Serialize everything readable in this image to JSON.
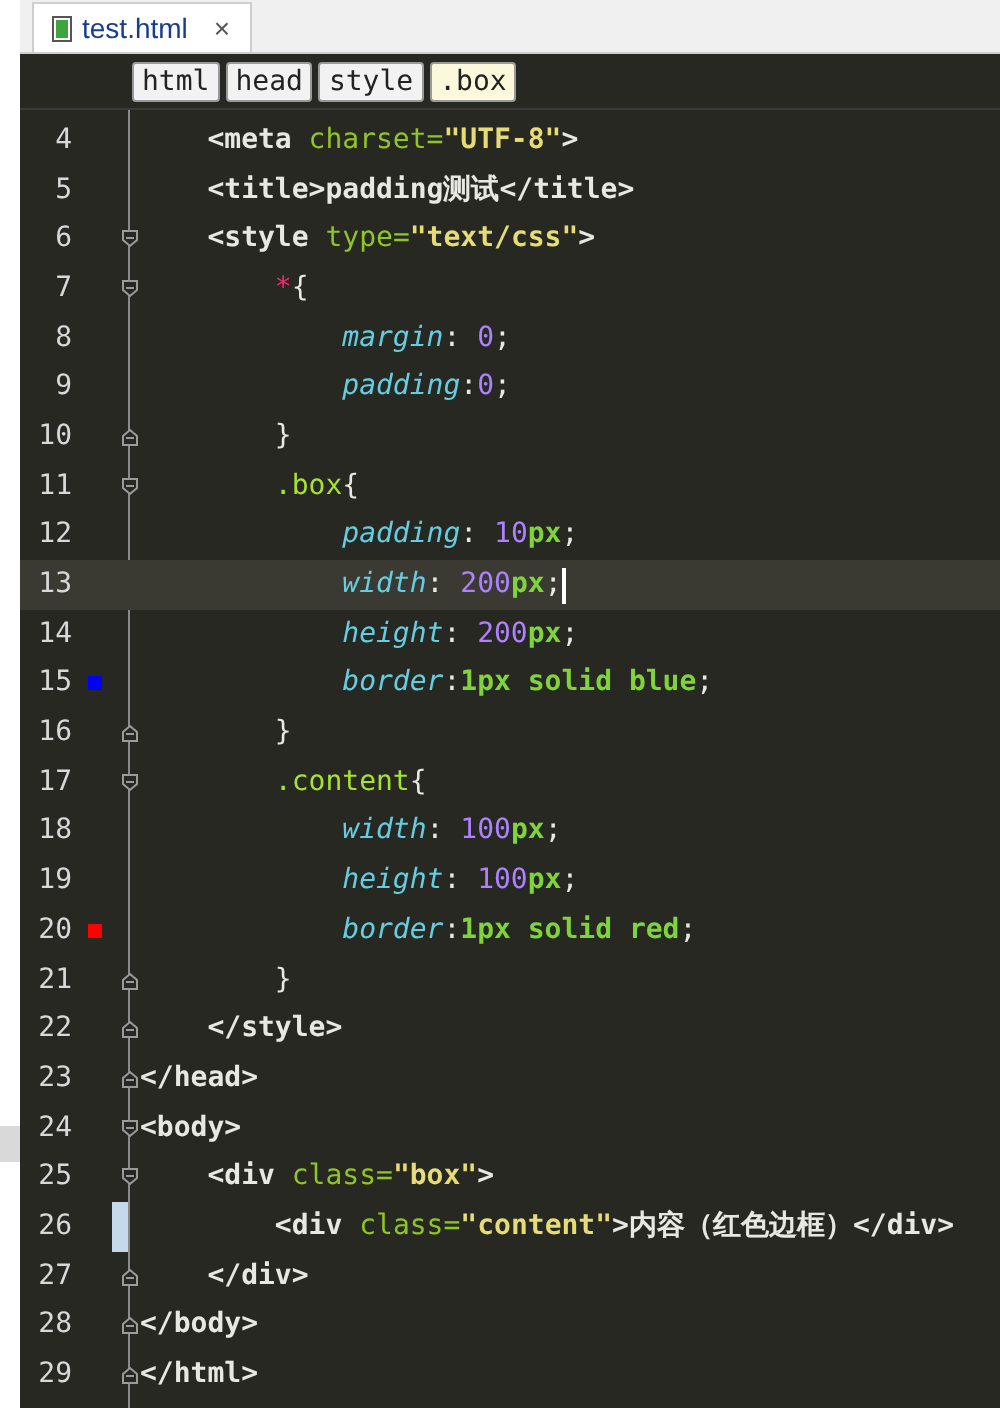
{
  "tab": {
    "title": "test.html",
    "close": "×",
    "selected": true
  },
  "breadcrumbs": [
    {
      "label": "html",
      "selected": false
    },
    {
      "label": "head",
      "selected": false
    },
    {
      "label": "style",
      "selected": false
    },
    {
      "label": ".box",
      "selected": true
    }
  ],
  "lines": [
    {
      "number": "4",
      "fold_start": false,
      "fold_end": false,
      "tokens": [
        {
          "text": "    <meta",
          "kind": "tag"
        },
        {
          "text": " charset=",
          "kind": "attr"
        },
        {
          "text": "\"UTF-8\"",
          "kind": "string"
        },
        {
          "text": ">",
          "kind": "tag"
        }
      ]
    },
    {
      "number": "5",
      "fold_start": false,
      "fold_end": false,
      "tokens": [
        {
          "text": "    <title>padding测试</title>",
          "kind": "tag"
        }
      ]
    },
    {
      "number": "6",
      "fold_start": true,
      "fold_end": false,
      "tokens": [
        {
          "text": "    <style",
          "kind": "tag"
        },
        {
          "text": " type=",
          "kind": "attr"
        },
        {
          "text": "\"text/css\"",
          "kind": "string"
        },
        {
          "text": ">",
          "kind": "tag"
        }
      ]
    },
    {
      "number": "7",
      "fold_start": true,
      "fold_end": false,
      "tokens": [
        {
          "text": "        *",
          "kind": "star"
        },
        {
          "text": "{",
          "kind": "plain"
        }
      ]
    },
    {
      "number": "8",
      "fold_start": false,
      "fold_end": false,
      "tokens": [
        {
          "text": "            margin",
          "kind": "property"
        },
        {
          "text": ": ",
          "kind": "plain"
        },
        {
          "text": "0",
          "kind": "number"
        },
        {
          "text": ";",
          "kind": "plain"
        }
      ]
    },
    {
      "number": "9",
      "fold_start": false,
      "fold_end": false,
      "tokens": [
        {
          "text": "            padding",
          "kind": "property"
        },
        {
          "text": ":",
          "kind": "plain"
        },
        {
          "text": "0",
          "kind": "number"
        },
        {
          "text": ";",
          "kind": "plain"
        }
      ]
    },
    {
      "number": "10",
      "fold_start": false,
      "fold_end": true,
      "tokens": [
        {
          "text": "        }",
          "kind": "plain"
        }
      ]
    },
    {
      "number": "11",
      "fold_start": true,
      "fold_end": false,
      "tokens": [
        {
          "text": "        .box",
          "kind": "selector"
        },
        {
          "text": "{",
          "kind": "plain"
        }
      ]
    },
    {
      "number": "12",
      "fold_start": false,
      "fold_end": false,
      "tokens": [
        {
          "text": "            padding",
          "kind": "property"
        },
        {
          "text": ": ",
          "kind": "plain"
        },
        {
          "text": "10",
          "kind": "number"
        },
        {
          "text": "px",
          "kind": "value"
        },
        {
          "text": ";",
          "kind": "plain"
        }
      ]
    },
    {
      "number": "13",
      "current": true,
      "fold_start": false,
      "fold_end": false,
      "tokens": [
        {
          "text": "            width",
          "kind": "property"
        },
        {
          "text": ": ",
          "kind": "plain"
        },
        {
          "text": "200",
          "kind": "number"
        },
        {
          "text": "px",
          "kind": "value"
        },
        {
          "text": ";",
          "kind": "plain"
        }
      ]
    },
    {
      "number": "14",
      "fold_start": false,
      "fold_end": false,
      "tokens": [
        {
          "text": "            height",
          "kind": "property"
        },
        {
          "text": ": ",
          "kind": "plain"
        },
        {
          "text": "200",
          "kind": "number"
        },
        {
          "text": "px",
          "kind": "value"
        },
        {
          "text": ";",
          "kind": "plain"
        }
      ]
    },
    {
      "number": "15",
      "color": "#0000ff",
      "fold_start": false,
      "fold_end": false,
      "tokens": [
        {
          "text": "            border",
          "kind": "property"
        },
        {
          "text": ":",
          "kind": "plain"
        },
        {
          "text": "1px solid blue",
          "kind": "value"
        },
        {
          "text": ";",
          "kind": "plain"
        }
      ]
    },
    {
      "number": "16",
      "fold_start": false,
      "fold_end": true,
      "tokens": [
        {
          "text": "        }",
          "kind": "plain"
        }
      ]
    },
    {
      "number": "17",
      "fold_start": true,
      "fold_end": false,
      "tokens": [
        {
          "text": "        .content",
          "kind": "selector"
        },
        {
          "text": "{",
          "kind": "plain"
        }
      ]
    },
    {
      "number": "18",
      "fold_start": false,
      "fold_end": false,
      "tokens": [
        {
          "text": "            width",
          "kind": "property"
        },
        {
          "text": ": ",
          "kind": "plain"
        },
        {
          "text": "100",
          "kind": "number"
        },
        {
          "text": "px",
          "kind": "value"
        },
        {
          "text": ";",
          "kind": "plain"
        }
      ]
    },
    {
      "number": "19",
      "fold_start": false,
      "fold_end": false,
      "tokens": [
        {
          "text": "            height",
          "kind": "property"
        },
        {
          "text": ": ",
          "kind": "plain"
        },
        {
          "text": "100",
          "kind": "number"
        },
        {
          "text": "px",
          "kind": "value"
        },
        {
          "text": ";",
          "kind": "plain"
        }
      ]
    },
    {
      "number": "20",
      "color": "#ff0000",
      "fold_start": false,
      "fold_end": false,
      "tokens": [
        {
          "text": "            border",
          "kind": "property"
        },
        {
          "text": ":",
          "kind": "plain"
        },
        {
          "text": "1px solid red",
          "kind": "value"
        },
        {
          "text": ";",
          "kind": "plain"
        }
      ]
    },
    {
      "number": "21",
      "fold_start": false,
      "fold_end": true,
      "tokens": [
        {
          "text": "        }",
          "kind": "plain"
        }
      ]
    },
    {
      "number": "22",
      "fold_start": false,
      "fold_end": true,
      "tokens": [
        {
          "text": "    </style>",
          "kind": "tag"
        }
      ]
    },
    {
      "number": "23",
      "fold_start": false,
      "fold_end": true,
      "tokens": [
        {
          "text": "</head>",
          "kind": "tag"
        }
      ]
    },
    {
      "number": "24",
      "fold_start": true,
      "fold_end": false,
      "tokens": [
        {
          "text": "<body>",
          "kind": "tag"
        }
      ]
    },
    {
      "number": "25",
      "fold_start": true,
      "fold_end": false,
      "tokens": [
        {
          "text": "    <div",
          "kind": "tag"
        },
        {
          "text": " class=",
          "kind": "attr"
        },
        {
          "text": "\"box\"",
          "kind": "string"
        },
        {
          "text": ">",
          "kind": "tag"
        }
      ]
    },
    {
      "number": "26",
      "changed": true,
      "fold_start": false,
      "fold_end": false,
      "tokens": [
        {
          "text": "        <div",
          "kind": "tag"
        },
        {
          "text": " class=",
          "kind": "attr"
        },
        {
          "text": "\"content\"",
          "kind": "string"
        },
        {
          "text": ">内容（红色边框）</div>",
          "kind": "tag"
        }
      ]
    },
    {
      "number": "27",
      "fold_start": false,
      "fold_end": true,
      "tokens": [
        {
          "text": "    </div>",
          "kind": "tag"
        }
      ]
    },
    {
      "number": "28",
      "fold_start": false,
      "fold_end": true,
      "tokens": [
        {
          "text": "</body>",
          "kind": "tag"
        }
      ]
    },
    {
      "number": "29",
      "fold_start": false,
      "fold_end": true,
      "tokens": [
        {
          "text": "</html>",
          "kind": "tag"
        }
      ]
    }
  ]
}
